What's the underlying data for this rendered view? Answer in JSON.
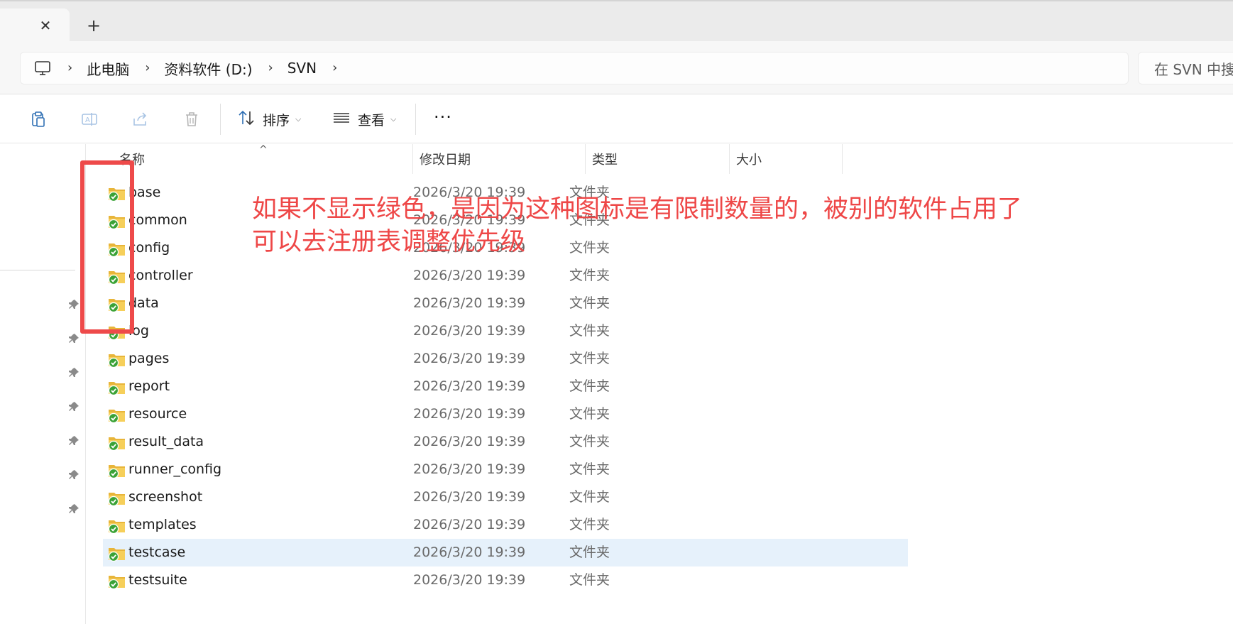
{
  "window": {
    "tab_close_symbol": "✕",
    "new_tab_symbol": "+"
  },
  "address": {
    "breadcrumbs": [
      "此电脑",
      "资料软件 (D:)",
      "SVN"
    ],
    "separator": "›",
    "search_placeholder": "在 SVN 中搜"
  },
  "toolbar": {
    "sort_label": "排序",
    "view_label": "查看",
    "more_label": "···",
    "icons": [
      "paste-icon",
      "rename-icon",
      "share-icon",
      "delete-icon",
      "sort-icon",
      "view-icon"
    ]
  },
  "columns": {
    "name": "名称",
    "modified": "修改日期",
    "type": "类型",
    "size": "大小"
  },
  "files": [
    {
      "name": "base",
      "date": "2026/3/20 19:39",
      "type": "文件夹"
    },
    {
      "name": "common",
      "date": "2026/3/20 19:39",
      "type": "文件夹"
    },
    {
      "name": "config",
      "date": "2026/3/20 19:39",
      "type": "文件夹"
    },
    {
      "name": "controller",
      "date": "2026/3/20 19:39",
      "type": "文件夹"
    },
    {
      "name": "data",
      "date": "2026/3/20 19:39",
      "type": "文件夹"
    },
    {
      "name": "log",
      "date": "2026/3/20 19:39",
      "type": "文件夹"
    },
    {
      "name": "pages",
      "date": "2026/3/20 19:39",
      "type": "文件夹"
    },
    {
      "name": "report",
      "date": "2026/3/20 19:39",
      "type": "文件夹"
    },
    {
      "name": "resource",
      "date": "2026/3/20 19:39",
      "type": "文件夹"
    },
    {
      "name": "result_data",
      "date": "2026/3/20 19:39",
      "type": "文件夹"
    },
    {
      "name": "runner_config",
      "date": "2026/3/20 19:39",
      "type": "文件夹"
    },
    {
      "name": "screenshot",
      "date": "2026/3/20 19:39",
      "type": "文件夹"
    },
    {
      "name": "templates",
      "date": "2026/3/20 19:39",
      "type": "文件夹"
    },
    {
      "name": "testcase",
      "date": "2026/3/20 19:39",
      "type": "文件夹",
      "selected": true
    },
    {
      "name": "testsuite",
      "date": "2026/3/20 19:39",
      "type": "文件夹"
    }
  ],
  "annotation": {
    "line1": "如果不显示绿色，是因为这种图标是有限制数量的，被别的软件占用了",
    "line2": "可以去注册表调整优先级",
    "color": "#ee4747"
  },
  "colors": {
    "selected_row": "#e6f1fb",
    "folder": "#f4c542",
    "svn_ok_badge": "#3aa236"
  }
}
